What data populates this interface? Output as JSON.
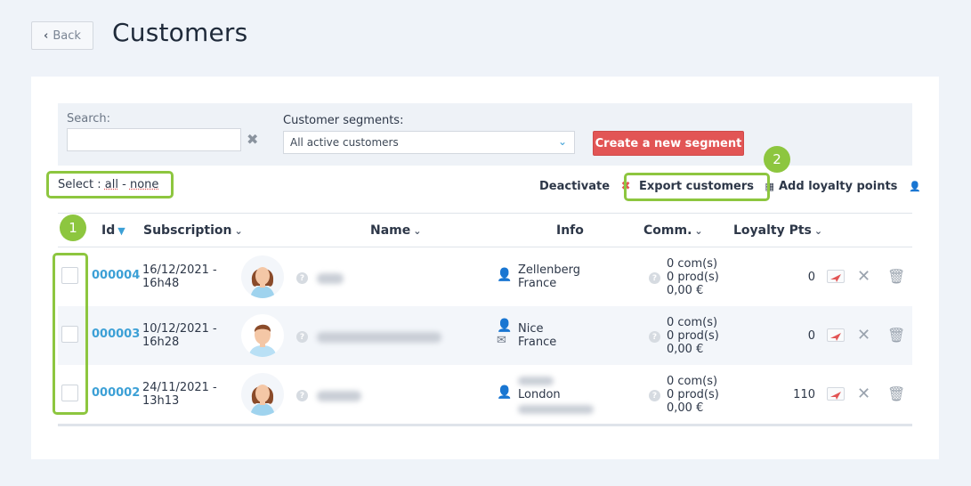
{
  "header": {
    "back_label": "Back",
    "title": "Customers"
  },
  "filters": {
    "search_label": "Search:",
    "search_value": "",
    "segments_label": "Customer segments:",
    "segments_value": "All active customers",
    "create_label": "Create a new segment"
  },
  "select": {
    "prefix": "Select :",
    "all": "all",
    "sep": "-",
    "none": "none"
  },
  "actions": {
    "deactivate": "Deactivate",
    "export": "Export customers",
    "loyalty": "Add loyalty points"
  },
  "annotations": {
    "badge1": "1",
    "badge2": "2"
  },
  "columns": {
    "id": "Id",
    "subscription": "Subscription",
    "name": "Name",
    "info": "Info",
    "comm": "Comm.",
    "loyalty": "Loyalty Pts"
  },
  "rows": [
    {
      "id": "000004",
      "sub1": "16/12/2021 -",
      "sub2": "16h48",
      "info1": "Zellenberg",
      "info2": "France",
      "c1": "0 com(s)",
      "c2": "0 prod(s)",
      "c3": "0,00 €",
      "pts": "0"
    },
    {
      "id": "000003",
      "sub1": "10/12/2021 -",
      "sub2": "16h28",
      "info1": "Nice",
      "info2": "France",
      "c1": "0 com(s)",
      "c2": "0 prod(s)",
      "c3": "0,00 €",
      "pts": "0"
    },
    {
      "id": "000002",
      "sub1": "24/11/2021 -",
      "sub2": "13h13",
      "info1": "London",
      "info2": "",
      "c1": "0 com(s)",
      "c2": "0 prod(s)",
      "c3": "0,00 €",
      "pts": "110"
    }
  ],
  "colors": {
    "accent": "#3ca0d6",
    "danger": "#e25555",
    "highlight": "#8dc63f"
  }
}
